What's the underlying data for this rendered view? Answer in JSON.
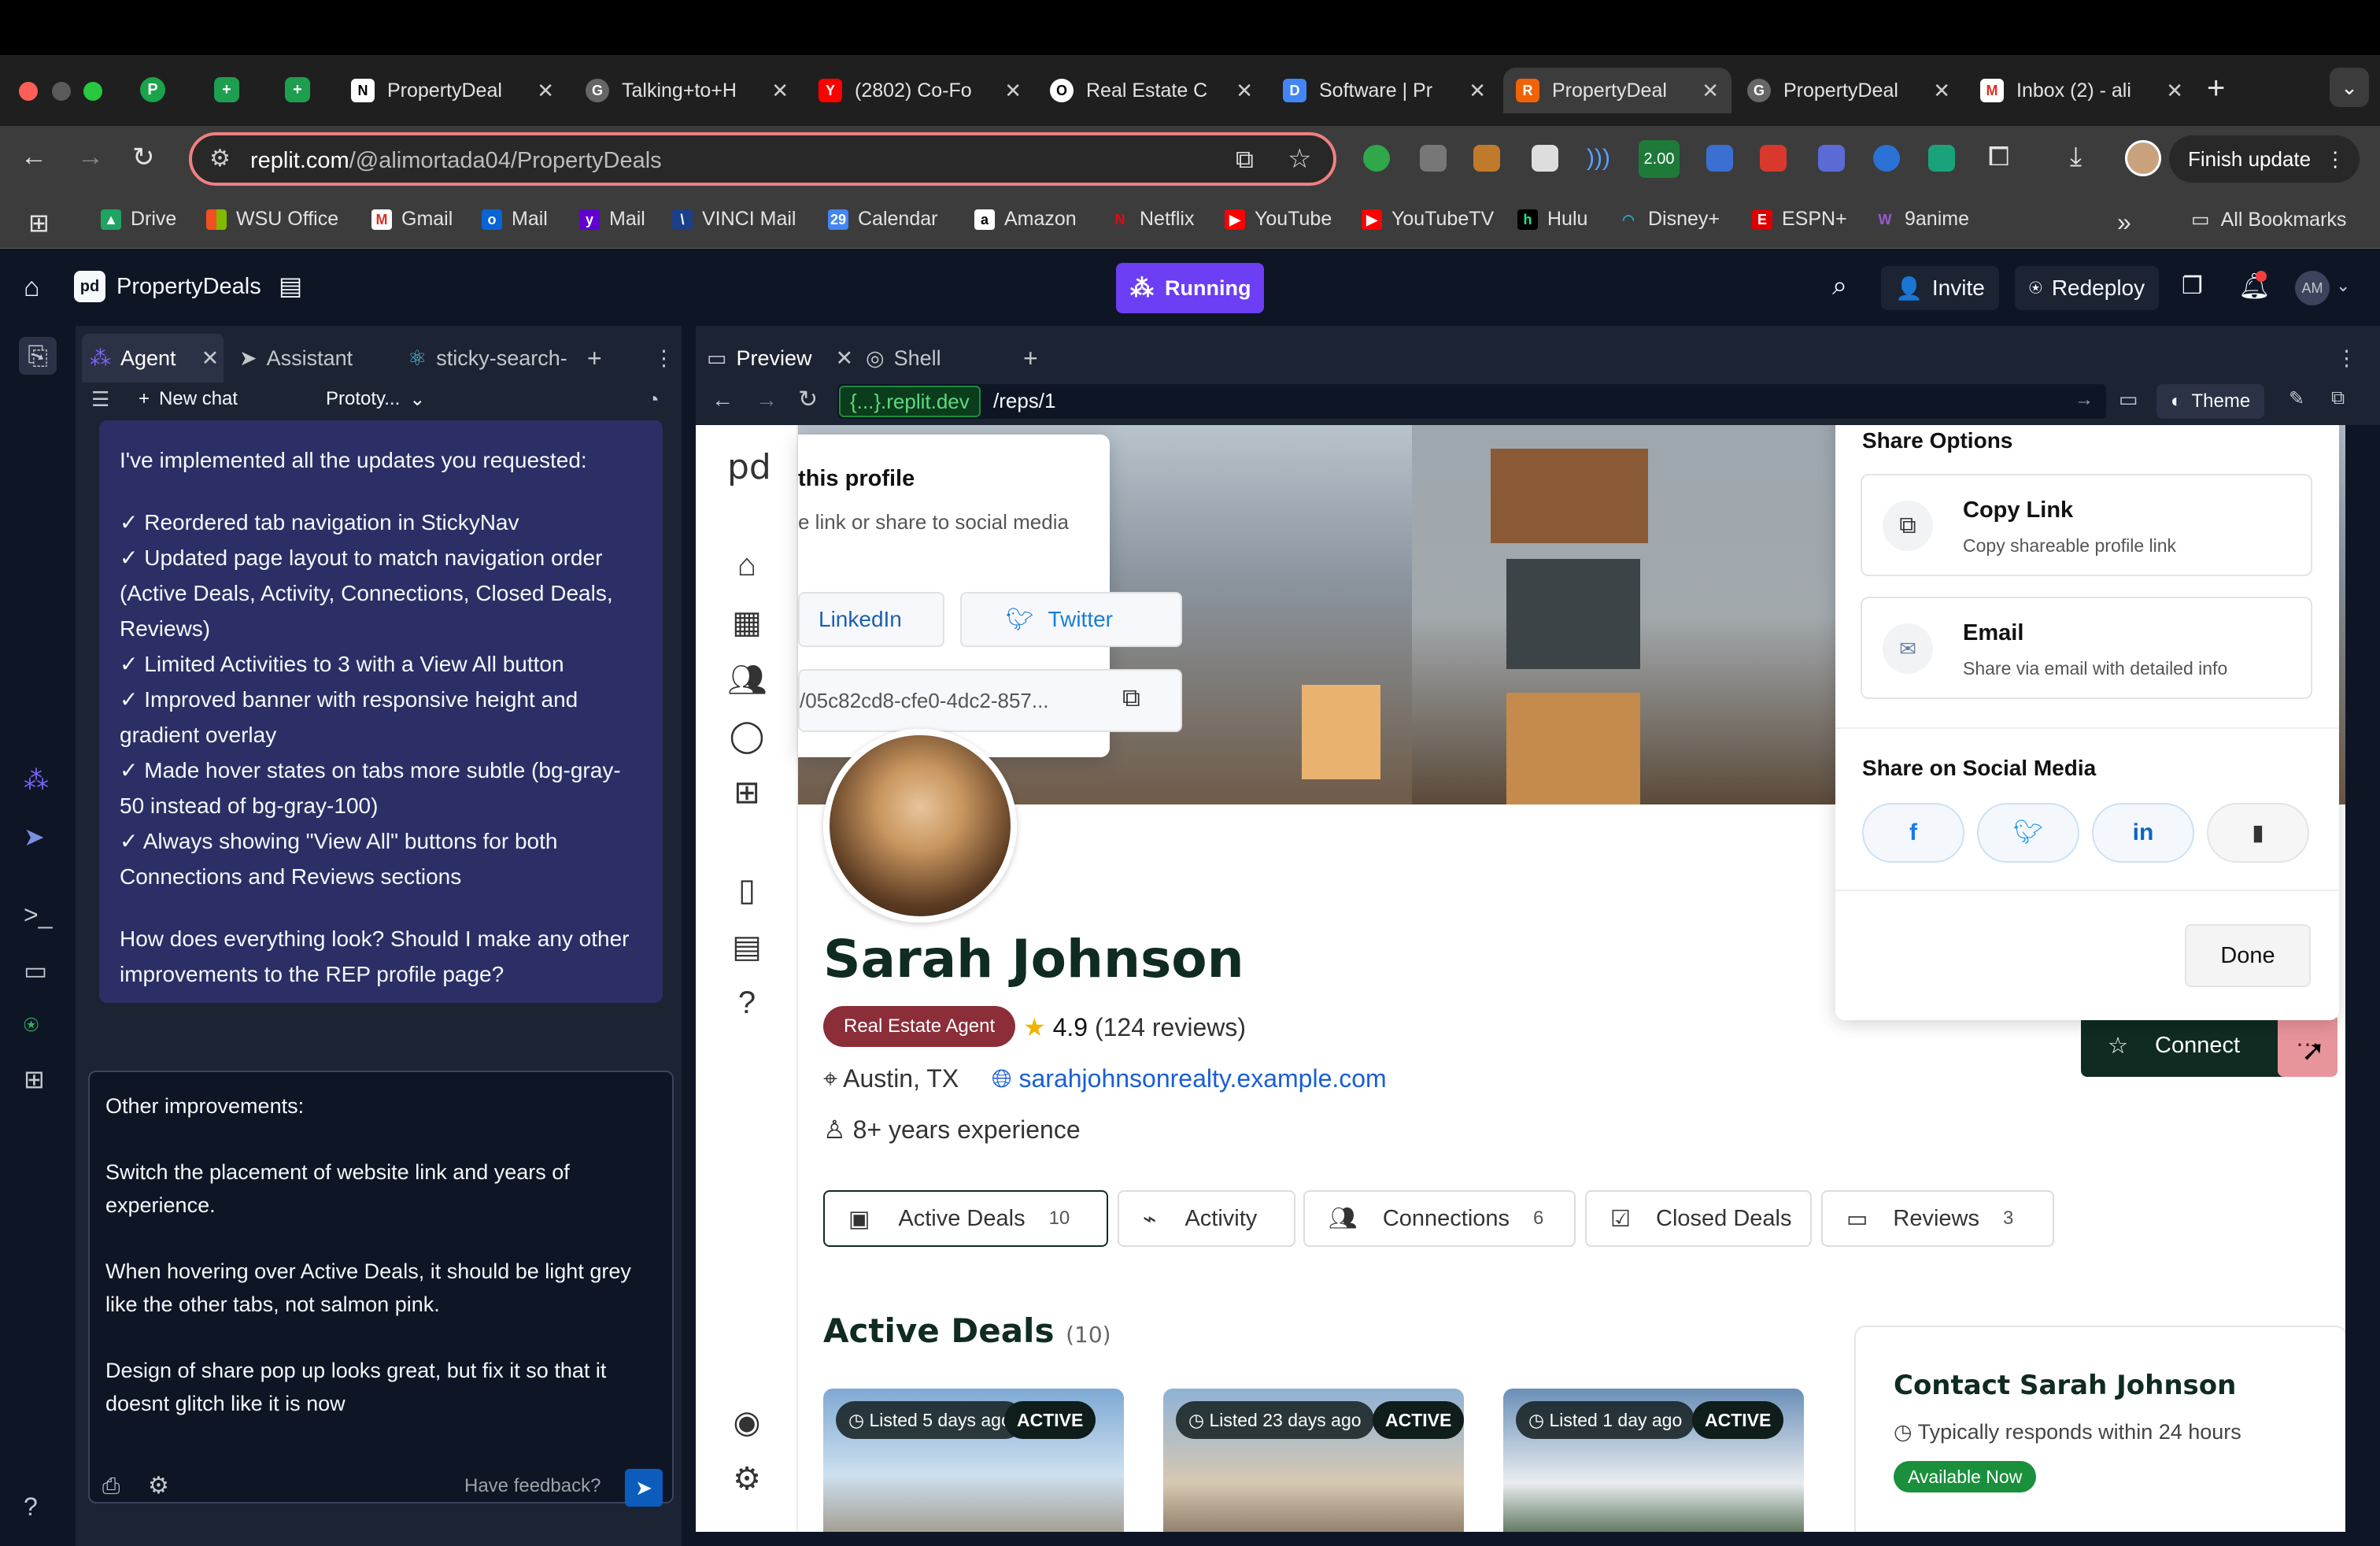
{
  "browser": {
    "tabs": [
      {
        "title": "PropertyDeal",
        "fav": "N"
      },
      {
        "title": "Talking+to+H",
        "fav": "G"
      },
      {
        "title": "(2802) Co-Fo",
        "fav": "Y"
      },
      {
        "title": "Real Estate C",
        "fav": "O"
      },
      {
        "title": "Software | Pr",
        "fav": "D"
      },
      {
        "title": "PropertyDeal",
        "fav": "R"
      },
      {
        "title": "PropertyDeal",
        "fav": "G"
      },
      {
        "title": "Inbox (2) - ali",
        "fav": "M"
      }
    ],
    "url_host": "replit.com",
    "url_path": "/@alimortada04/PropertyDeals",
    "finish_update": "Finish update",
    "ext_badge": "2.00",
    "bookmarks": [
      "Drive",
      "WSU Office",
      "Gmail",
      "Mail",
      "Mail",
      "VINCI Mail",
      "Calendar",
      "Amazon",
      "Netflix",
      "YouTube",
      "YouTubeTV",
      "Hulu",
      "Disney+",
      "ESPN+",
      "9anime"
    ],
    "all_bookmarks": "All Bookmarks"
  },
  "replit": {
    "project_name": "PropertyDeals",
    "running": "Running",
    "invite": "Invite",
    "redeploy": "Redeploy",
    "avatar": "AM"
  },
  "agent": {
    "tabs": [
      "Agent",
      "Assistant",
      "sticky-search-"
    ],
    "new_chat": "New chat",
    "mode": "Prototy...",
    "message_intro": "I've implemented all the updates you requested:",
    "message_items": [
      "✓ Reordered tab navigation in StickyNav",
      "✓ Updated page layout to match navigation order (Active Deals, Activity, Connections, Closed Deals, Reviews)",
      "✓ Limited Activities to 3 with a View All button",
      "✓ Improved banner with responsive height and gradient overlay",
      "✓ Made hover states on tabs more subtle (bg-gray-50 instead of bg-gray-100)",
      "✓ Always showing \"View All\" buttons for both Connections and Reviews sections"
    ],
    "message_outro": "How does everything look? Should I make any other improvements to the REP profile page?",
    "input_lines": [
      "Other improvements:",
      "",
      "Switch the placement of website link and years of experience.",
      "",
      "When hovering over Active Deals, it should be light grey like the other tabs, not salmon pink.",
      "",
      "Design of share pop up looks great, but fix it so that it doesnt glitch like it is now"
    ],
    "feedback": "Have feedback?"
  },
  "preview": {
    "tabs": [
      "Preview",
      "Shell"
    ],
    "domain": "{...}.replit.dev",
    "path": "/reps/1",
    "theme": "Theme"
  },
  "profile": {
    "logo": "pd",
    "share_left_title": "this profile",
    "share_left_sub": "e link or share to social media",
    "linkedin": "LinkedIn",
    "twitter": "Twitter",
    "link_value": "/05c82cd8-cfe0-4dc2-857...",
    "name": "Sarah Johnson",
    "role": "Real Estate Agent",
    "rating": "4.9",
    "reviews": "(124 reviews)",
    "location": "Austin, TX",
    "website": "sarahjohnsonrealty.example.com",
    "experience": "8+ years experience",
    "connect": "Connect",
    "tabs": [
      {
        "label": "Active Deals",
        "count": "10"
      },
      {
        "label": "Activity",
        "count": ""
      },
      {
        "label": "Connections",
        "count": "6"
      },
      {
        "label": "Closed Deals",
        "count": ""
      },
      {
        "label": "Reviews",
        "count": "3"
      }
    ],
    "section_title": "Active Deals",
    "section_count": "(10)",
    "deals": [
      {
        "listed": "Listed 5 days ago",
        "status": "ACTIVE"
      },
      {
        "listed": "Listed 23 days ago",
        "status": "ACTIVE"
      },
      {
        "listed": "Listed 1 day ago",
        "status": "ACTIVE"
      }
    ],
    "contact_title": "Contact Sarah Johnson",
    "contact_sub": "Typically responds within 24 hours",
    "available": "Available Now"
  },
  "share_popup": {
    "title": "Share Options",
    "copy_link": "Copy Link",
    "copy_link_sub": "Copy shareable profile link",
    "email": "Email",
    "email_sub": "Share via email with detailed info",
    "social_title": "Share on Social Media",
    "done": "Done"
  }
}
